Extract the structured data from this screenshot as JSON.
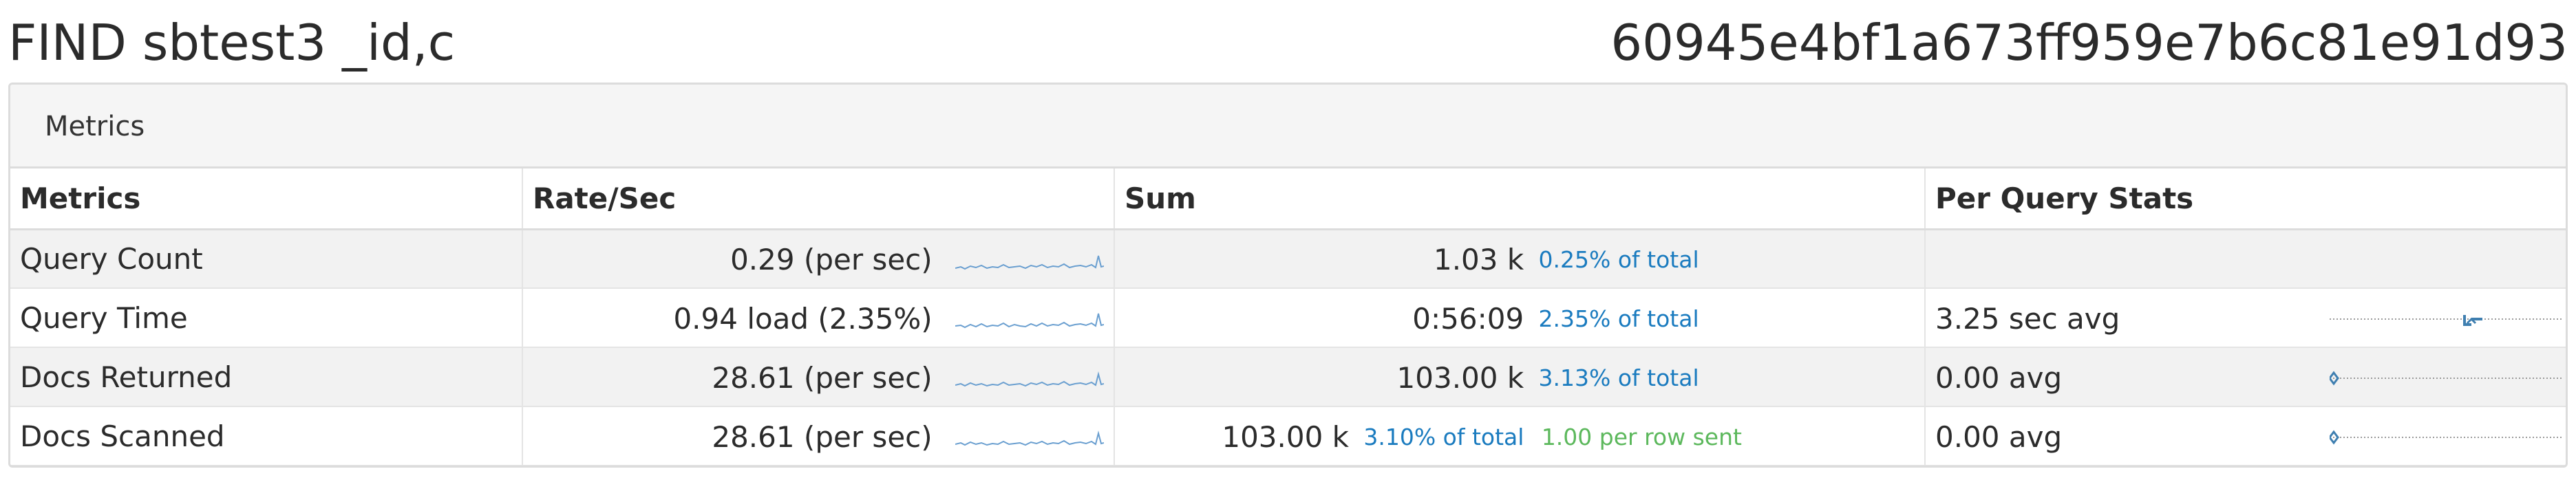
{
  "header": {
    "query_title": "FIND sbtest3 _id,c",
    "query_id": "60945e4bf1a673ff959e7b6c81e91d93"
  },
  "panel": {
    "title": "Metrics"
  },
  "table": {
    "columns": [
      "Metrics",
      "Rate/Sec",
      "Sum",
      "Per Query Stats"
    ],
    "rows": [
      {
        "metric": "Query Count",
        "rate": "0.29 (per sec)",
        "sum": "1.03 k",
        "pct": "0.25% of total",
        "extra": "",
        "per_query": ""
      },
      {
        "metric": "Query Time",
        "rate": "0.94 load (2.35%)",
        "sum": "0:56:09",
        "pct": "2.35% of total",
        "extra": "",
        "per_query": "3.25 sec avg"
      },
      {
        "metric": "Docs Returned",
        "rate": "28.61 (per sec)",
        "sum": "103.00 k",
        "pct": "3.13% of total",
        "extra": "",
        "per_query": "0.00  avg"
      },
      {
        "metric": "Docs Scanned",
        "rate": "28.61 (per sec)",
        "sum": "103.00 k",
        "pct": "3.10% of total",
        "extra": "1.00 per row sent",
        "per_query": "0.00  avg"
      }
    ]
  },
  "colors": {
    "accent": "#1a7bbf",
    "sparkline": "#6a9fd0",
    "ratio_green": "#5cb85c",
    "stripe": "#f2f2f2"
  }
}
